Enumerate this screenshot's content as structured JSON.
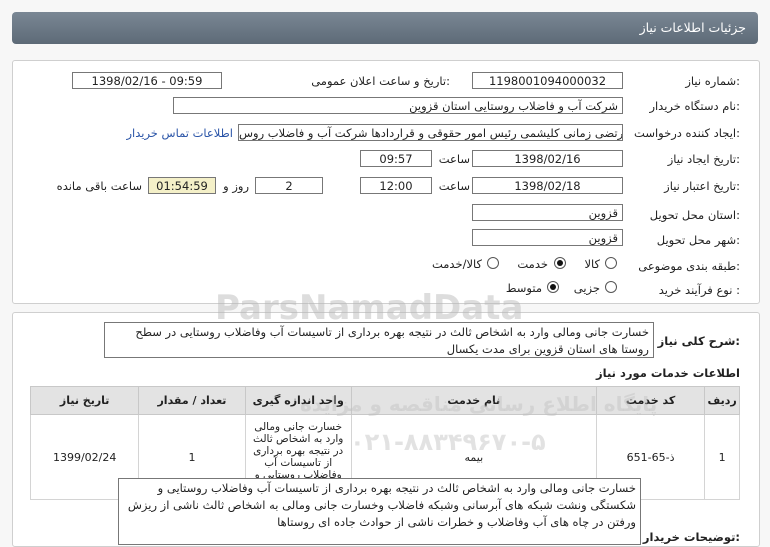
{
  "header": {
    "title": "جزئیات اطلاعات نیاز"
  },
  "fields": {
    "need_number_label": "شماره نیاز:",
    "need_number": "1198001094000032",
    "announce_label": "تاریخ و ساعت اعلان عمومی:",
    "announce_value": "1398/02/16 - 09:59",
    "buyer_label": "نام دستگاه خریدار:",
    "buyer_value": "شرکت آب و فاضلاب روستایی استان قزوین",
    "creator_label": "ایجاد کننده درخواست:",
    "creator_value": "مرتضی زمانی کلیشمی رئیس امور حقوقی و قراردادها شرکت آب و فاضلاب روس",
    "contact_link": "اطلاعات تماس خریدار",
    "created_label": "تاریخ ایجاد نیاز:",
    "created_date": "1398/02/16",
    "time_label": "ساعت",
    "created_time": "09:57",
    "validity_label": "تاریخ اعتبار نیاز:",
    "validity_date": "1398/02/18",
    "validity_time": "12:00",
    "days_value": "2",
    "days_label": "روز و",
    "remaining_time": "01:54:59",
    "remaining_label": "ساعت باقی مانده",
    "province_label": "استان محل تحویل:",
    "province_value": "قزوین",
    "city_label": "شهر محل تحویل:",
    "city_value": "قزوین",
    "category_label": "طبقه بندی موضوعی:",
    "category_options": [
      "کالا",
      "خدمت",
      "کالا/خدمت"
    ],
    "category_selected": "خدمت",
    "process_label": "نوع فرآیند خرید :",
    "process_options": [
      "جزیی",
      "متوسط"
    ],
    "process_selected": "متوسط"
  },
  "summary": {
    "label": "شرح کلی نیاز:",
    "text": "خسارت جانی ومالی وارد به اشخاص ثالث در نتیجه بهره برداری از تاسیسات آب وفاضلاب روستایی در سطح روستا های استان قزوین برای مدت یکسال"
  },
  "services": {
    "section_title": "اطلاعات خدمات مورد نیاز",
    "columns": [
      "ردیف",
      "کد خدمت",
      "نام خدمت",
      "واحد اندازه گیری",
      "تعداد / مقدار",
      "تاریخ نیاز"
    ],
    "rows": [
      {
        "index": "1",
        "code": "ذ-65-651",
        "name": "بیمه",
        "unit": "خسارت جانی ومالی وارد به اشخاص ثالث در نتیجه بهره برداری از تاسیسات آب وفاضلاب روستایی و شکستگی ونشت",
        "quantity": "1",
        "date": "1399/02/24"
      }
    ]
  },
  "buyer_notes": {
    "label": "توضیحات خریدار:",
    "text": "خسارت جانی ومالی وارد به اشخاص ثالث در نتیجه بهره برداری از تاسیسات آب وفاضلاب روستایی و شکستگی ونشت شبکه های آبرسانی وشبکه فاضلاب  وخسارت جانی ومالی به اشخاص ثالث ناشی از ریزش ورفتن در چاه های آب وفاضلاب و خطرات ناشی از حوادث جاده ای روستاها"
  },
  "watermark": {
    "brand": "ParsNamadData",
    "line1": "پایگاه اطلاع رسانی مناقصه و مزایده",
    "phone": "۰۲۱-۸۸۳۴۹۶۷۰-۵"
  },
  "colors": {
    "header_bg": "#6b7885",
    "link": "#2b55a8",
    "remaining_bg": "#f4f0c8"
  }
}
